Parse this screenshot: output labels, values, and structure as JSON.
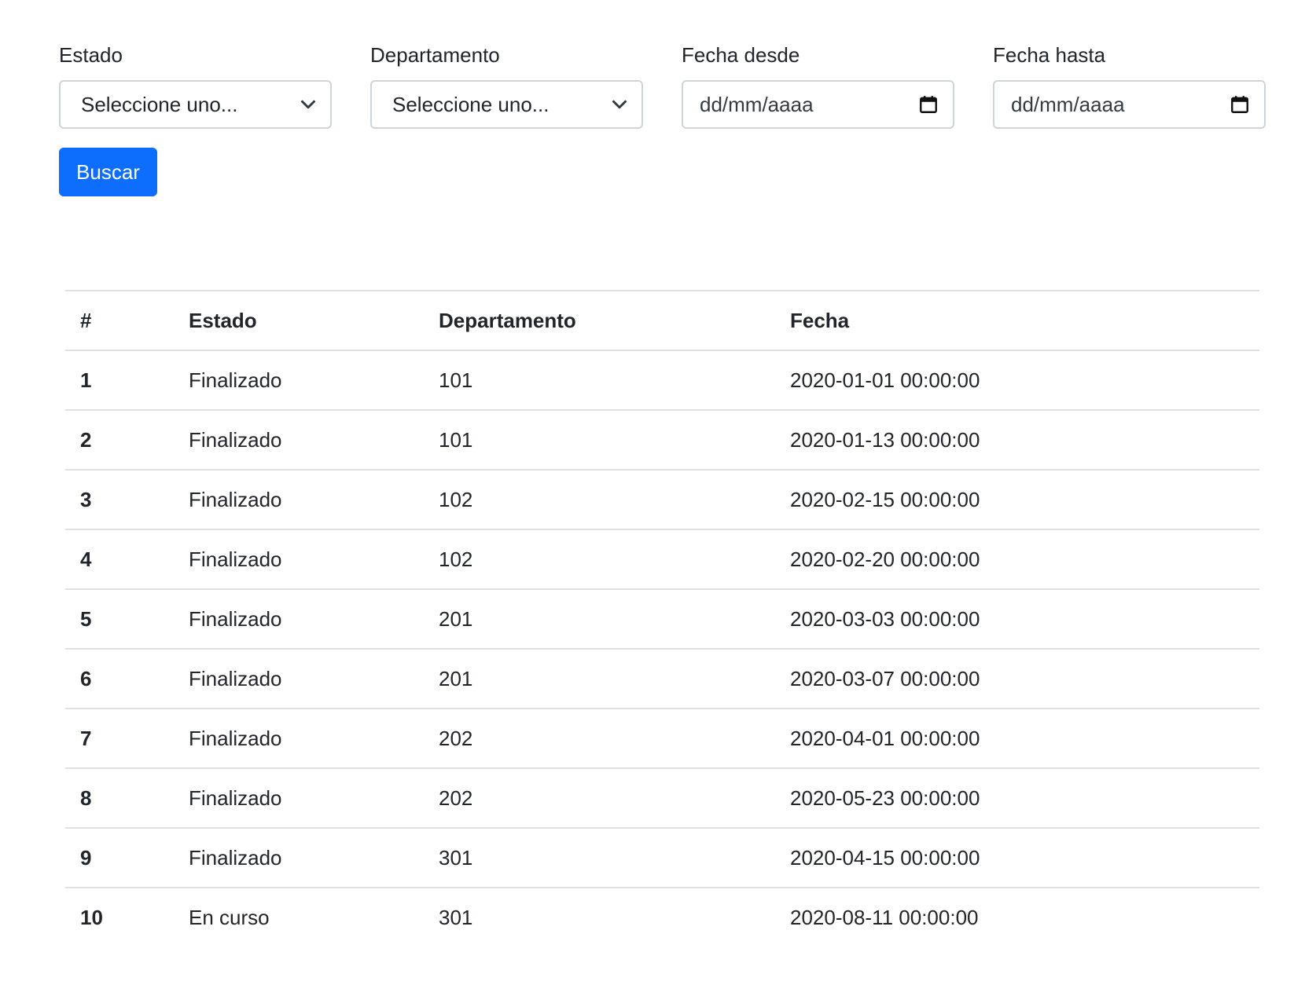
{
  "filters": {
    "estado": {
      "label": "Estado",
      "value": "Seleccione uno..."
    },
    "departamento": {
      "label": "Departamento",
      "value": "Seleccione uno..."
    },
    "fecha_desde": {
      "label": "Fecha desde",
      "placeholder": "dd/mm/aaaa"
    },
    "fecha_hasta": {
      "label": "Fecha hasta",
      "placeholder": "dd/mm/aaaa"
    }
  },
  "search_button": {
    "label": "Buscar",
    "color": "#0d6efd"
  },
  "table": {
    "headers": [
      "#",
      "Estado",
      "Departamento",
      "Fecha"
    ],
    "rows": [
      [
        "1",
        "Finalizado",
        "101",
        "2020-01-01 00:00:00"
      ],
      [
        "2",
        "Finalizado",
        "101",
        "2020-01-13 00:00:00"
      ],
      [
        "3",
        "Finalizado",
        "102",
        "2020-02-15 00:00:00"
      ],
      [
        "4",
        "Finalizado",
        "102",
        "2020-02-20 00:00:00"
      ],
      [
        "5",
        "Finalizado",
        "201",
        "2020-03-03 00:00:00"
      ],
      [
        "6",
        "Finalizado",
        "201",
        "2020-03-07 00:00:00"
      ],
      [
        "7",
        "Finalizado",
        "202",
        "2020-04-01 00:00:00"
      ],
      [
        "8",
        "Finalizado",
        "202",
        "2020-05-23 00:00:00"
      ],
      [
        "9",
        "Finalizado",
        "301",
        "2020-04-15 00:00:00"
      ],
      [
        "10",
        "En curso",
        "301",
        "2020-08-11 00:00:00"
      ]
    ]
  },
  "icons": {
    "select_arrow": "chevron-down-icon",
    "date_picker": "calendar-icon"
  }
}
